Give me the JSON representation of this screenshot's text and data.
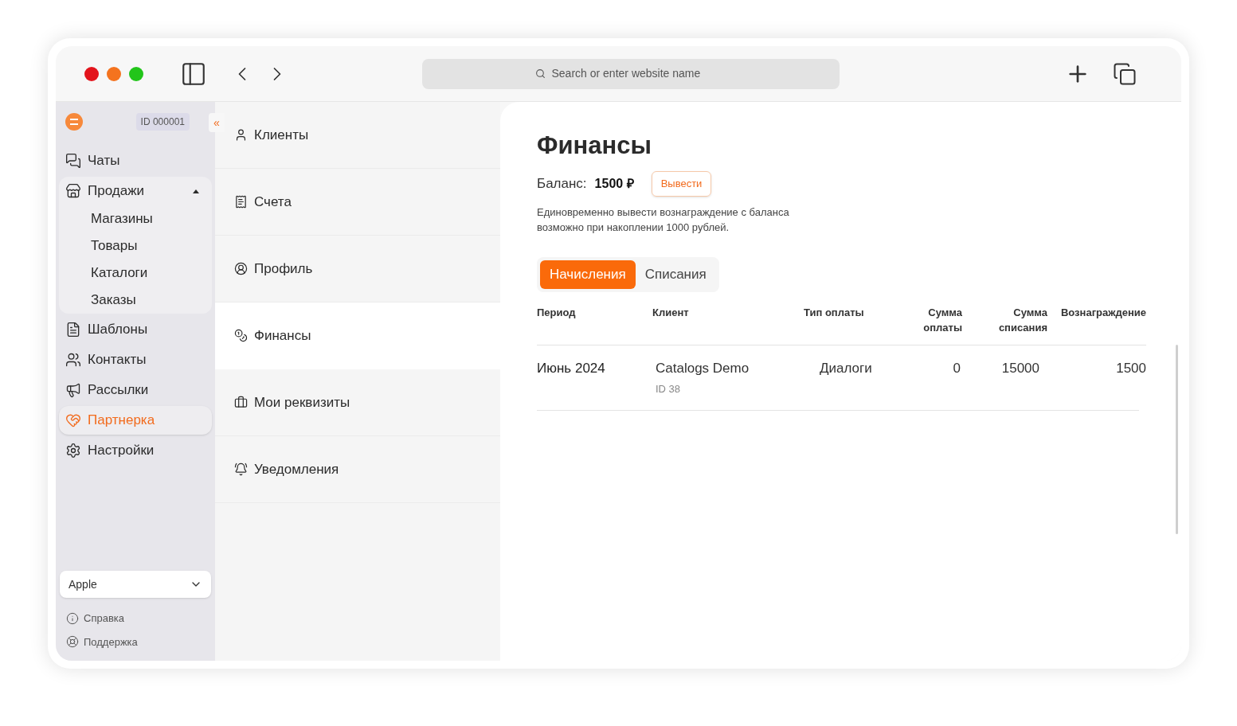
{
  "browser": {
    "address_placeholder": "Search or enter website name"
  },
  "sidebar": {
    "account_id": "ID 000001",
    "collapse": "«",
    "items": [
      {
        "label": "Чаты",
        "selected": false
      },
      {
        "label": "Продажи",
        "selected": false,
        "expanded": true,
        "children": [
          {
            "label": "Магазины"
          },
          {
            "label": "Товары"
          },
          {
            "label": "Каталоги"
          },
          {
            "label": "Заказы"
          }
        ]
      },
      {
        "label": "Шаблоны",
        "selected": false
      },
      {
        "label": "Контакты",
        "selected": false
      },
      {
        "label": "Рассылки",
        "selected": false
      },
      {
        "label": "Партнерка",
        "selected": true
      },
      {
        "label": "Настройки",
        "selected": false
      }
    ],
    "store_select": {
      "value": "Apple"
    },
    "footer_links": [
      "Справка",
      "Поддержка"
    ]
  },
  "submenu": [
    {
      "label": "Клиенты",
      "selected": false
    },
    {
      "label": "Счета",
      "selected": false
    },
    {
      "label": "Профиль",
      "selected": false
    },
    {
      "label": "Финансы",
      "selected": true
    },
    {
      "label": "Мои реквизиты",
      "selected": false
    },
    {
      "label": "Уведомления",
      "selected": false
    }
  ],
  "content": {
    "title": "Финансы",
    "balance_label": "Баланс:",
    "balance_value": "1500 ₽",
    "withdraw_button": "Вывести",
    "note": "Единовременно вывести вознаграждение с баланса возможно при накоплении 1000 рублей.",
    "tabs": [
      {
        "label": "Начисления",
        "selected": true
      },
      {
        "label": "Списания",
        "selected": false
      }
    ],
    "table": {
      "columns": [
        {
          "label": "Период"
        },
        {
          "label": "Клиент"
        },
        {
          "label": "Тип оплаты"
        },
        {
          "label": "Сумма оплаты"
        },
        {
          "label": "Сумма списания"
        },
        {
          "label": "Вознаграждение"
        }
      ],
      "rows": [
        {
          "period": "Июнь 2024",
          "client": "Catalogs Demo",
          "client_id": "ID 38",
          "payment_type": "Диалоги",
          "payment_sum": "0",
          "writeoff_sum": "15000",
          "reward": "1500"
        }
      ]
    }
  }
}
